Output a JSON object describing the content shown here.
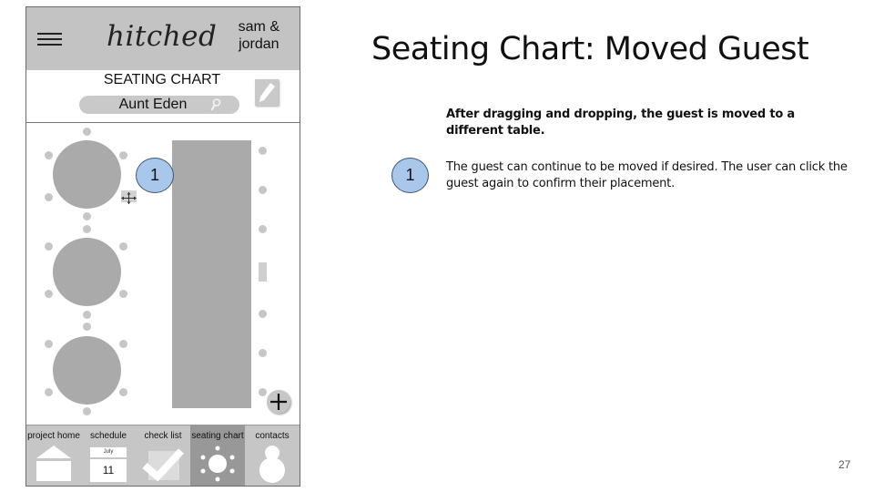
{
  "slide": {
    "title": "Seating Chart: Moved Guest",
    "intro": "After dragging and dropping, the guest is moved to a different table.",
    "notes": [
      {
        "marker": "1",
        "text": "The guest can continue to be moved if desired. The user can click the guest again to confirm their placement."
      }
    ],
    "page_number": "27"
  },
  "app": {
    "logo": "hitched",
    "couple_line1": "sam &",
    "couple_line2": "jordan",
    "page_title": "SEATING CHART",
    "search_value": "Aunt Eden",
    "guest_marker": "1",
    "colors": {
      "header_bg": "#c3c3c3",
      "table": "#aaaaaa",
      "seat": "#c6c6c6",
      "marker_fill": "#a8c7ea",
      "marker_border": "#3e5673",
      "active_tab": "#989898"
    },
    "tabs": [
      {
        "label": "project home",
        "icon": "house-icon",
        "active": false
      },
      {
        "label": "schedule",
        "icon": "calendar-icon",
        "active": false,
        "month": "July",
        "day": "11"
      },
      {
        "label": "check list",
        "icon": "checkmark-icon",
        "active": false
      },
      {
        "label": "seating chart",
        "icon": "table-icon",
        "active": true
      },
      {
        "label": "contacts",
        "icon": "person-icon",
        "active": false
      }
    ]
  }
}
